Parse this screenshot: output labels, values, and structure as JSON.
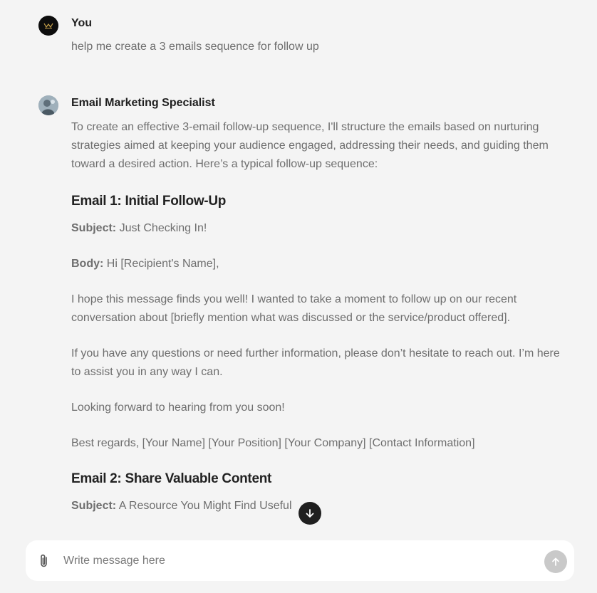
{
  "user": {
    "name": "You",
    "message": "help me create a 3 emails sequence for follow up"
  },
  "assistant": {
    "name": "Email Marketing Specialist",
    "intro": "To create an effective 3-email follow-up sequence, I'll structure the emails based on nurturing strategies aimed at keeping your audience engaged, addressing their needs, and guiding them toward a desired action. Here’s a typical follow-up sequence:",
    "email1": {
      "heading": "Email 1: Initial Follow-Up",
      "subject_label": "Subject:",
      "subject": " Just Checking In!",
      "body_label": "Body:",
      "body_greeting": " Hi [Recipient's Name],",
      "para1": "I hope this message finds you well! I wanted to take a moment to follow up on our recent conversation about [briefly mention what was discussed or the service/product offered].",
      "para2": "If you have any questions or need further information, please don’t hesitate to reach out. I’m here to assist you in any way I can.",
      "para3": "Looking forward to hearing from you soon!",
      "signoff": "Best regards, [Your Name] [Your Position] [Your Company] [Contact Information]"
    },
    "email2": {
      "heading": "Email 2: Share Valuable Content",
      "subject_label": "Subject:",
      "subject": " A Resource You Might Find Useful"
    }
  },
  "composer": {
    "placeholder": "Write message here"
  },
  "icons": {
    "scroll": "arrow-down-icon",
    "attach": "paperclip-icon",
    "send": "arrow-up-icon"
  },
  "colors": {
    "background": "#f4f4f4",
    "composer_bg": "#ffffff",
    "send_button": "#c9c9c9",
    "scroll_button": "#1f1f1f"
  }
}
